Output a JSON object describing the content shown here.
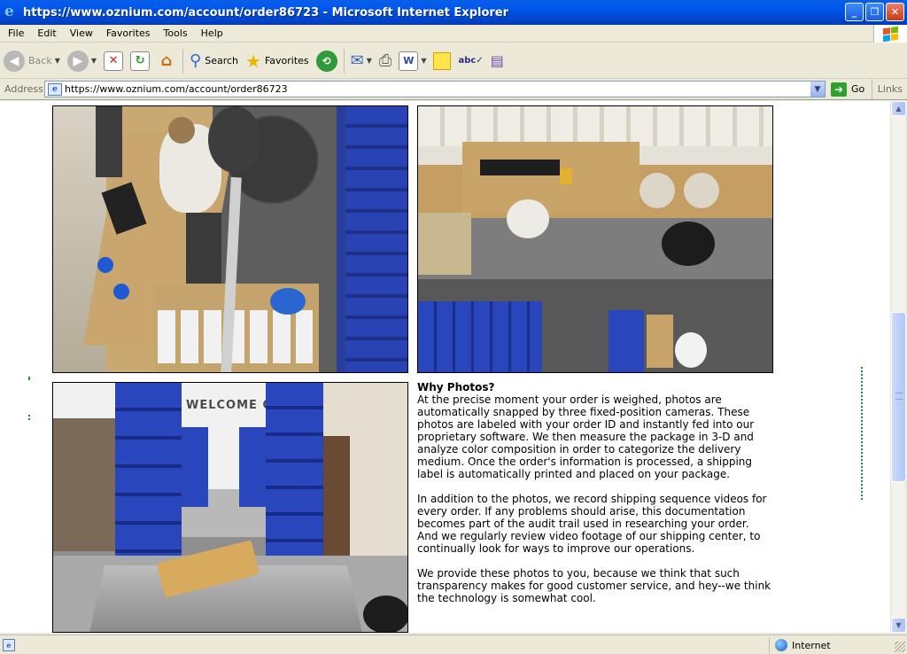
{
  "window": {
    "title": "https://www.oznium.com/account/order86723 - Microsoft Internet Explorer",
    "controls": {
      "minimize": "_",
      "maximize": "❐",
      "close": "✕"
    }
  },
  "menu": {
    "items": [
      "File",
      "Edit",
      "View",
      "Favorites",
      "Tools",
      "Help"
    ]
  },
  "toolbar": {
    "back_label": "Back",
    "search_label": "Search",
    "favorites_label": "Favorites"
  },
  "address": {
    "label": "Address",
    "url": "https://www.oznium.com/account/order86723",
    "go_label": "Go",
    "links_label": "Links"
  },
  "article": {
    "heading": "Why Photos?",
    "paragraphs": [
      "At the precise moment your order is weighed, photos are automatically snapped by three fixed-position cameras. These photos are labeled with your order ID and instantly fed into our proprietary software. We then measure the package in 3-D and analyze color composition in order to categorize the delivery medium. Once the order's information is processed, a shipping label is automatically printed and placed on your package.",
      "In addition to the photos, we record shipping sequence videos for every order. If any problems should arise, this documentation becomes part of the audit trail used in researching your order. And we regularly review video footage of our shipping center, to continually look for ways to improve our operations.",
      "We provide these photos to you, because we think that such transparency makes for good customer service, and hey--we think the technology is somewhat cool."
    ]
  },
  "photos": {
    "sign_text": "WELCOME Oznium"
  },
  "status": {
    "zone": "Internet"
  },
  "colors": {
    "titlebar": "#0058ee",
    "chrome": "#ece9d8",
    "bin_blue": "#2a44b8",
    "dotted_green": "#2c8a2c"
  }
}
